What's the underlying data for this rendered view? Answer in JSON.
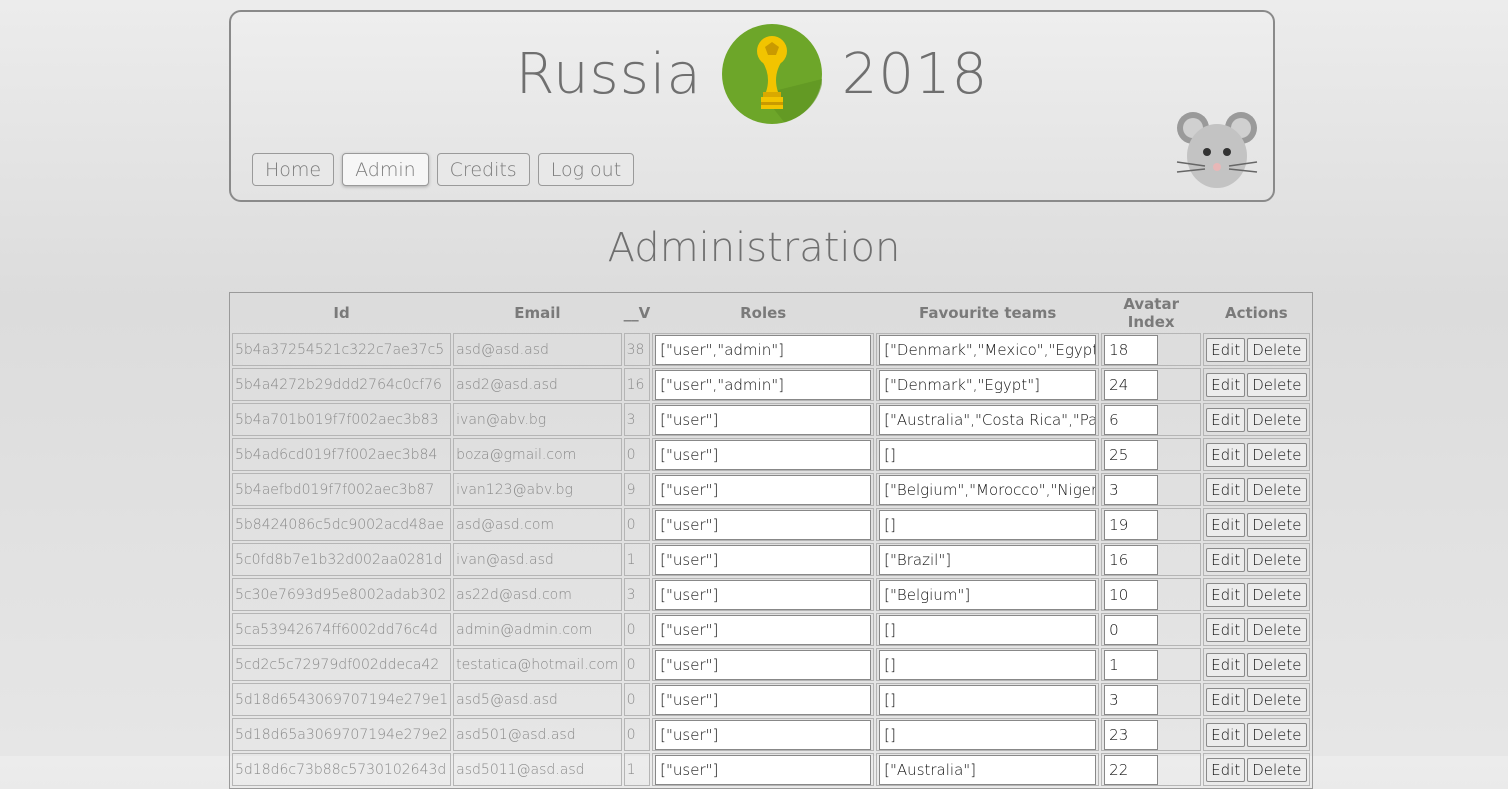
{
  "header": {
    "title_left": "Russia",
    "title_right": "2018",
    "nav": [
      {
        "label": "Home"
      },
      {
        "label": "Admin"
      },
      {
        "label": "Credits"
      },
      {
        "label": "Log out"
      }
    ]
  },
  "page": {
    "heading": "Administration"
  },
  "table": {
    "columns": [
      "Id",
      "Email",
      "__V",
      "Roles",
      "Favourite teams",
      "Avatar Index",
      "Actions"
    ],
    "edit_label": "Edit",
    "delete_label": "Delete",
    "rows": [
      {
        "id": "5b4a37254521c322c7ae37c5",
        "email": "asd@asd.asd",
        "v": "38",
        "roles": "[\"user\",\"admin\"]",
        "teams": "[\"Denmark\",\"Mexico\",\"Egypt\",",
        "avatar": "18"
      },
      {
        "id": "5b4a4272b29ddd2764c0cf76",
        "email": "asd2@asd.asd",
        "v": "16",
        "roles": "[\"user\",\"admin\"]",
        "teams": "[\"Denmark\",\"Egypt\"]",
        "avatar": "24"
      },
      {
        "id": "5b4a701b019f7f002aec3b83",
        "email": "ivan@abv.bg",
        "v": "3",
        "roles": "[\"user\"]",
        "teams": "[\"Australia\",\"Costa Rica\",\"Pana",
        "avatar": "6"
      },
      {
        "id": "5b4ad6cd019f7f002aec3b84",
        "email": "boza@gmail.com",
        "v": "0",
        "roles": "[\"user\"]",
        "teams": "[]",
        "avatar": "25"
      },
      {
        "id": "5b4aefbd019f7f002aec3b87",
        "email": "ivan123@abv.bg",
        "v": "9",
        "roles": "[\"user\"]",
        "teams": "[\"Belgium\",\"Morocco\",\"Nigeri",
        "avatar": "3"
      },
      {
        "id": "5b8424086c5dc9002acd48ae",
        "email": "asd@asd.com",
        "v": "0",
        "roles": "[\"user\"]",
        "teams": "[]",
        "avatar": "19"
      },
      {
        "id": "5c0fd8b7e1b32d002aa0281d",
        "email": "ivan@asd.asd",
        "v": "1",
        "roles": "[\"user\"]",
        "teams": "[\"Brazil\"]",
        "avatar": "16"
      },
      {
        "id": "5c30e7693d95e8002adab302",
        "email": "as22d@asd.com",
        "v": "3",
        "roles": "[\"user\"]",
        "teams": "[\"Belgium\"]",
        "avatar": "10"
      },
      {
        "id": "5ca53942674ff6002dd76c4d",
        "email": "admin@admin.com",
        "v": "0",
        "roles": "[\"user\"]",
        "teams": "[]",
        "avatar": "0"
      },
      {
        "id": "5cd2c5c72979df002ddeca42",
        "email": "testatica@hotmail.com",
        "v": "0",
        "roles": "[\"user\"]",
        "teams": "[]",
        "avatar": "1"
      },
      {
        "id": "5d18d6543069707194e279e1",
        "email": "asd5@asd.asd",
        "v": "0",
        "roles": "[\"user\"]",
        "teams": "[]",
        "avatar": "3"
      },
      {
        "id": "5d18d65a3069707194e279e2",
        "email": "asd501@asd.asd",
        "v": "0",
        "roles": "[\"user\"]",
        "teams": "[]",
        "avatar": "23"
      },
      {
        "id": "5d18d6c73b88c5730102643d",
        "email": "asd5011@asd.asd",
        "v": "1",
        "roles": "[\"user\"]",
        "teams": "[\"Australia\"]",
        "avatar": "22"
      }
    ]
  }
}
